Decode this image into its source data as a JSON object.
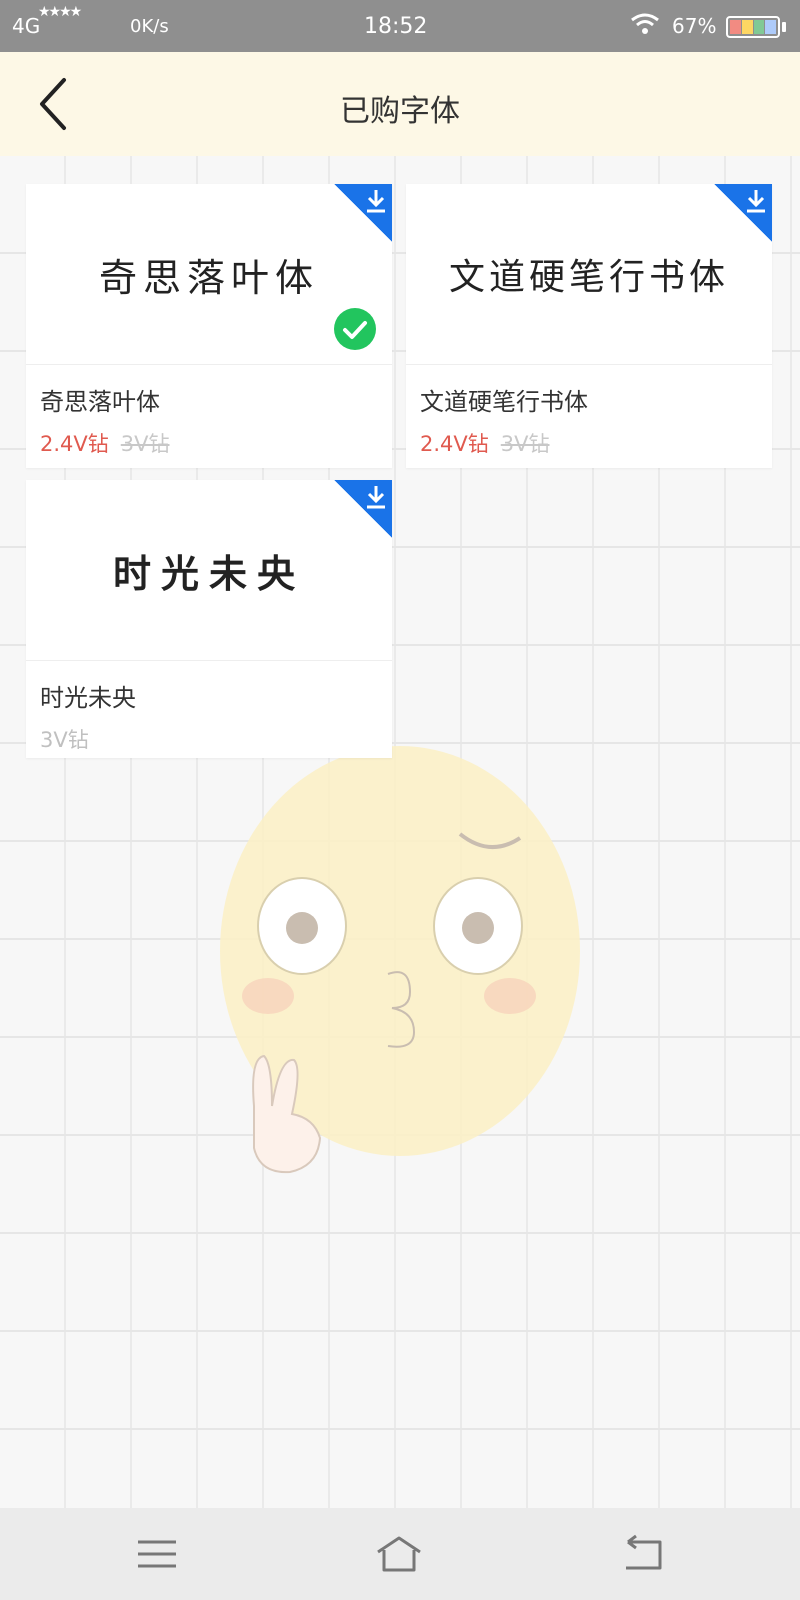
{
  "status_bar": {
    "network": "4G",
    "speed": "0K/s",
    "time": "18:52",
    "battery": "67%"
  },
  "header": {
    "title": "已购字体",
    "back_icon": "chevron-left-icon"
  },
  "fonts": [
    {
      "preview": "奇思落叶体",
      "name": "奇思落叶体",
      "price": "2.4V钻",
      "original_price": "3V钻",
      "downloaded": true,
      "selected": true
    },
    {
      "preview": "文道硬笔行书体",
      "name": "文道硬笔行书体",
      "price": "2.4V钻",
      "original_price": "3V钻",
      "downloaded": true,
      "selected": false
    },
    {
      "preview": "时光未央",
      "name": "时光未央",
      "price": "3V钻",
      "downloaded": true,
      "selected": false
    }
  ],
  "colors": {
    "accent_blue": "#1a73e8",
    "price_red": "#e05a4f",
    "check_green": "#22c55e",
    "header_bg": "#fdf8e6"
  },
  "navbar": {
    "menu_icon": "menu-icon",
    "home_icon": "home-icon",
    "back_icon": "back-icon"
  }
}
